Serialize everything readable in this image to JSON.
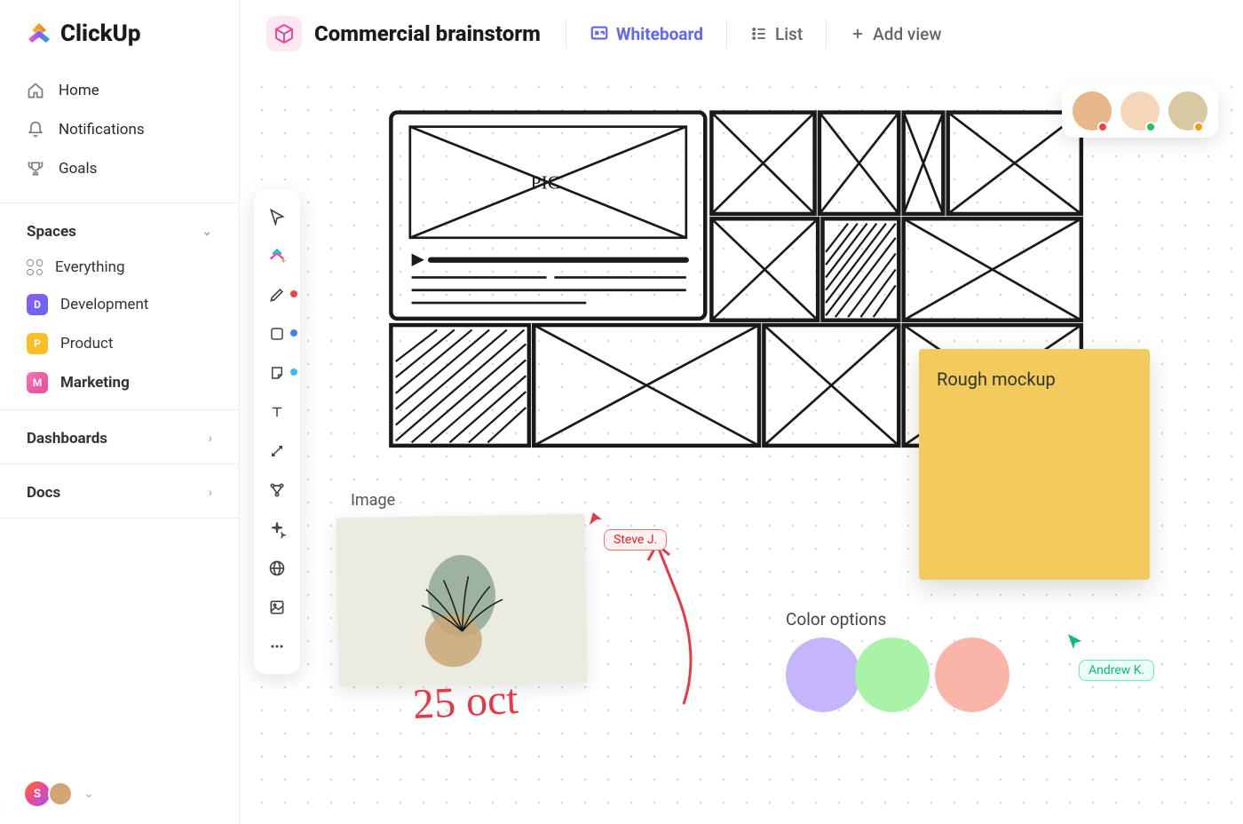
{
  "brand": {
    "name": "ClickUp"
  },
  "nav": {
    "home": "Home",
    "notifications": "Notifications",
    "goals": "Goals"
  },
  "spaces": {
    "header": "Spaces",
    "everything": "Everything",
    "items": [
      {
        "letter": "D",
        "label": "Development"
      },
      {
        "letter": "P",
        "label": "Product"
      },
      {
        "letter": "M",
        "label": "Marketing"
      }
    ]
  },
  "sections": {
    "dashboards": "Dashboards",
    "docs": "Docs"
  },
  "header": {
    "title": "Commercial brainstorm",
    "whiteboard": "Whiteboard",
    "list": "List",
    "add_view": "Add view"
  },
  "canvas": {
    "sticky_text": "Rough mockup",
    "image_label": "Image",
    "handwrite": "25 oct",
    "color_options_label": "Color options",
    "sketch_pic_label": "PIC"
  },
  "cursors": {
    "steve": "Steve J.",
    "andrew": "Andrew K."
  },
  "collaborators": [
    {
      "bg": "#e8b88a",
      "dot": "#ef4444"
    },
    {
      "bg": "#f4d7b8",
      "dot": "#22c55e"
    },
    {
      "bg": "#d9c9a3",
      "dot": "#f59e0b"
    }
  ],
  "colors": {
    "purple": "#c4b5fd",
    "green": "#a7f3a7",
    "coral": "#fbb4a8"
  },
  "user": {
    "initial": "S"
  }
}
